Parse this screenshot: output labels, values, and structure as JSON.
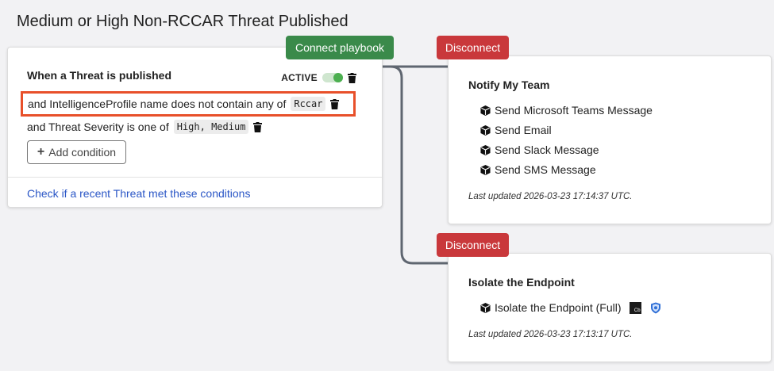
{
  "page": {
    "title": "Medium or High Non-RCCAR Threat Published"
  },
  "trigger": {
    "heading": "When a Threat is published",
    "status_label": "ACTIVE",
    "conditions": [
      {
        "text": "and IntelligenceProfile name does not contain any of",
        "value": "Rccar"
      },
      {
        "text": "and Threat Severity is one of",
        "value": "High, Medium"
      }
    ],
    "add_condition_label": "Add condition",
    "check_link": "Check if a recent Threat met these conditions"
  },
  "connect_label": "Connect playbook",
  "disconnect_label": "Disconnect",
  "actions": [
    {
      "title": "Notify My Team",
      "steps": [
        "Send Microsoft Teams Message",
        "Send Email",
        "Send Slack Message",
        "Send SMS Message"
      ],
      "last_updated": "Last updated 2026-03-23 17:14:37 UTC."
    },
    {
      "title": "Isolate the Endpoint",
      "steps": [
        "Isolate the Endpoint (Full)"
      ],
      "step_badge_text": "Cb",
      "last_updated": "Last updated 2026-03-23 17:13:17 UTC."
    }
  ],
  "colors": {
    "connect_button": "#3a8a4a",
    "disconnect_button": "#c9383b",
    "highlight_border": "#e8502a",
    "link": "#2a56c6"
  },
  "icons": [
    "trash-icon",
    "cube-icon",
    "plus-icon",
    "toggle-icon",
    "shield-icon",
    "carbon-black-icon"
  ]
}
